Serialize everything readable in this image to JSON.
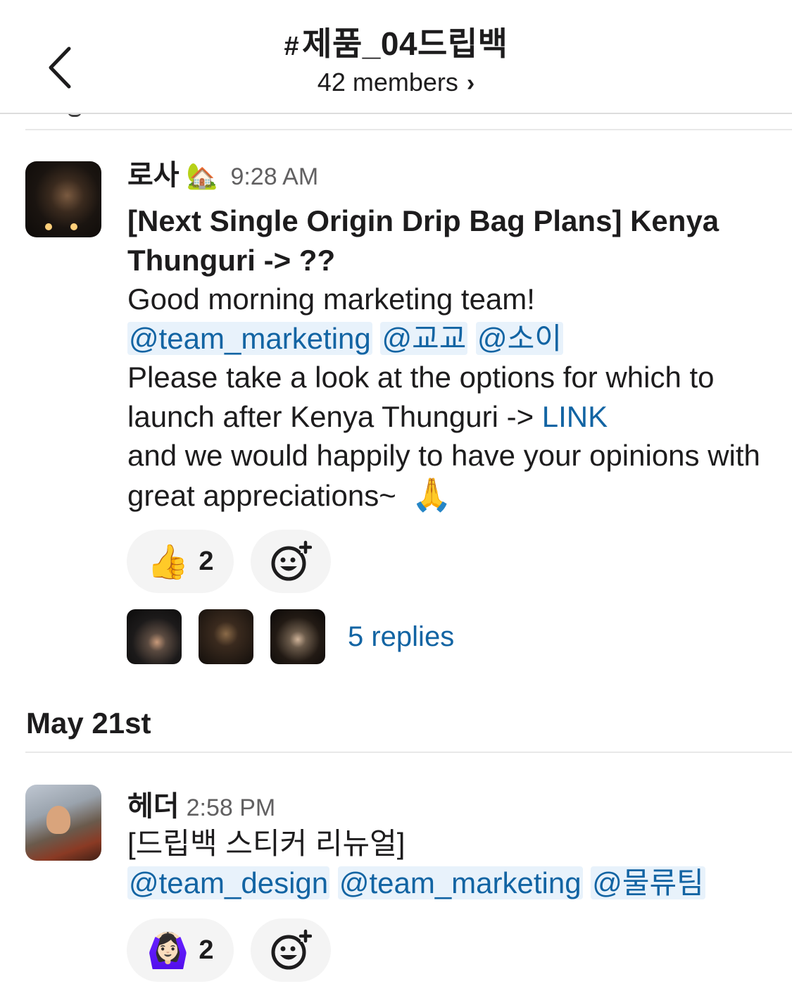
{
  "header": {
    "hash": "#",
    "channel_name": "제품_04드립백",
    "members_label": "42 members",
    "members_chevron": "›"
  },
  "messages": [
    {
      "author": "로사",
      "status_emoji": "🏡",
      "time": "9:28 AM",
      "title": "[Next Single Origin Drip Bag Plans] Kenya Thunguri -> ??",
      "greeting": "Good morning marketing team!",
      "mentions": [
        "@team_marketing",
        "@교교",
        "@소이"
      ],
      "text_1": "Please take a look at the options for which to launch after Kenya Thunguri -> ",
      "link": "LINK",
      "text_2": "and we would happily to have your opinions with great appreciations~",
      "trailing_emoji": "🙏",
      "reaction": {
        "emoji": "👍",
        "count": "2"
      },
      "add_reaction_icon": "add-reaction-icon",
      "replies": "5 replies"
    },
    {
      "author": "헤더",
      "time": "2:58 PM",
      "text": "[드립백 스티커 리뉴얼]",
      "mentions": [
        "@team_design",
        "@team_marketing",
        "@물류팀"
      ],
      "reaction": {
        "emoji": "🙆🏻‍♀️",
        "count": "2"
      },
      "add_reaction_icon": "add-reaction-icon"
    }
  ],
  "date_separator": "May 21st",
  "colors": {
    "link": "#1264a3",
    "mention_bg": "#e8f2fb",
    "reaction_bg": "#f4f4f4",
    "timestamp": "#616061"
  }
}
